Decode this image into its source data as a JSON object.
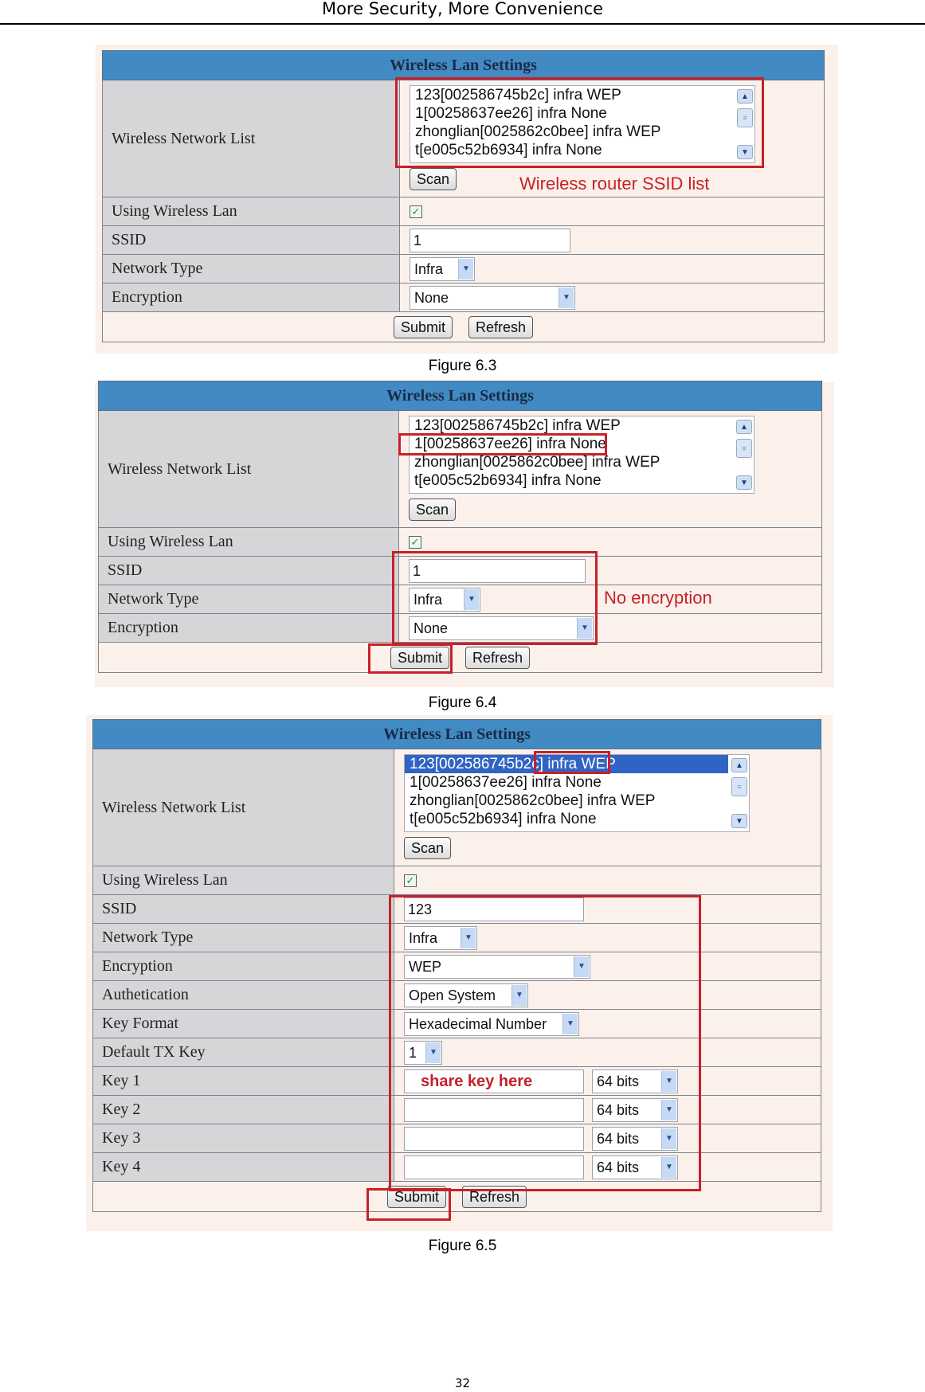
{
  "page": {
    "header": "More Security, More Convenience",
    "page_number": "32"
  },
  "networks": [
    "123[002586745b2c] infra WEP",
    "1[00258637ee26] infra None",
    "zhonglian[0025862c0bee] infra WEP",
    "t[e005c52b6934] infra None"
  ],
  "labels": {
    "title": "Wireless Lan Settings",
    "network_list": "Wireless Network List",
    "using_wireless": "Using Wireless Lan",
    "ssid": "SSID",
    "network_type": "Network Type",
    "encryption": "Encryption",
    "authentication": "Authetication",
    "key_format": "Key Format",
    "default_tx_key": "Default TX Key",
    "key1": "Key 1",
    "key2": "Key 2",
    "key3": "Key 3",
    "key4": "Key 4",
    "scan": "Scan",
    "submit": "Submit",
    "refresh": "Refresh"
  },
  "icons": {
    "checkbox": "✓",
    "dropdown": "▼",
    "scroll_up": "▲",
    "scroll_down": "▼",
    "scroll_thumb": "≡"
  },
  "figures": [
    {
      "caption": "Figure 6.3",
      "using_wireless_checked": true,
      "ssid": "1",
      "network_type": "Infra",
      "encryption": "None",
      "annotation": "Wireless router SSID list"
    },
    {
      "caption": "Figure 6.4",
      "using_wireless_checked": true,
      "selected_network_index": 1,
      "ssid": "1",
      "network_type": "Infra",
      "encryption": "None",
      "annotation": "No encryption"
    },
    {
      "caption": "Figure 6.5",
      "using_wireless_checked": true,
      "selected_network_index": 0,
      "ssid": "123",
      "network_type": "Infra",
      "encryption": "WEP",
      "authentication": "Open System",
      "key_format": "Hexadecimal Number",
      "default_tx_key": "1",
      "key1_hint": "share key here",
      "key_bits": [
        "64 bits",
        "64 bits",
        "64 bits",
        "64 bits"
      ]
    }
  ],
  "colors": {
    "header_blue": "#418ac3",
    "label_gray": "#d6d6d8",
    "value_bg": "#fbf1ea",
    "annotation_red": "#c8202a",
    "selection_blue": "#3064c4"
  }
}
